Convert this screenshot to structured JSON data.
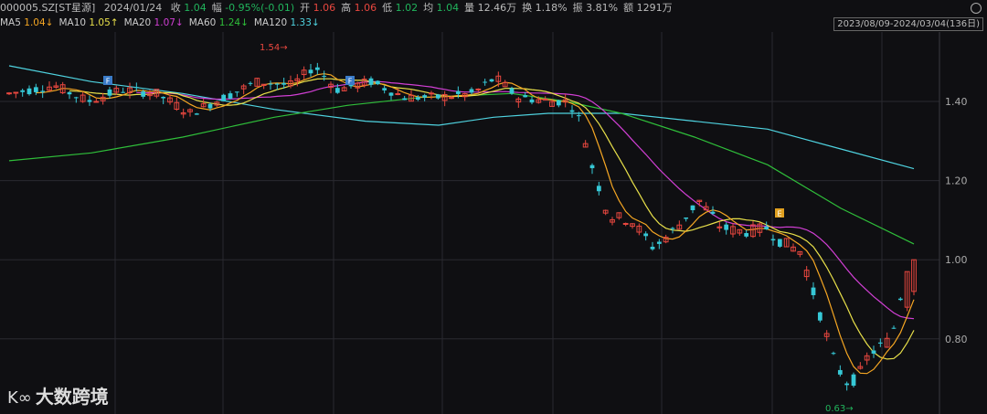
{
  "header": {
    "symbol": "000005.SZ[ST星源]",
    "date": "2024/01/24",
    "items": [
      {
        "label": "收",
        "value": "1.04",
        "color": "green"
      },
      {
        "label": "幅",
        "value": "-0.95%(-0.01)",
        "color": "green"
      },
      {
        "label": "开",
        "value": "1.06",
        "color": "red"
      },
      {
        "label": "高",
        "value": "1.06",
        "color": "red"
      },
      {
        "label": "低",
        "value": "1.02",
        "color": "green"
      },
      {
        "label": "均",
        "value": "1.04",
        "color": "green"
      },
      {
        "label": "量",
        "value": "12.46万",
        "color": "gray"
      },
      {
        "label": "换",
        "value": "1.18%",
        "color": "gray"
      },
      {
        "label": "振",
        "value": "3.81%",
        "color": "gray"
      },
      {
        "label": "额",
        "value": "1291万",
        "color": "gray"
      }
    ]
  },
  "ma_legend": [
    {
      "name": "MA5",
      "value": "1.04",
      "arrow": "↓",
      "color": "#f5a623"
    },
    {
      "name": "MA10",
      "value": "1.05",
      "arrow": "↑",
      "color": "#e8e04a"
    },
    {
      "name": "MA20",
      "value": "1.07",
      "arrow": "↓",
      "color": "#d13fd4"
    },
    {
      "name": "MA60",
      "value": "1.24",
      "arrow": "↓",
      "color": "#2fbf3a"
    },
    {
      "name": "MA120",
      "value": "1.33",
      "arrow": "↓",
      "color": "#4fd3e0"
    }
  ],
  "date_range": "2023/08/09-2024/03/04(136日)",
  "logo_text": "大数跨境",
  "logo_mark": "K∞",
  "colors": {
    "up": "#e8473f",
    "down": "#36c8d6",
    "bg": "#0f0f12",
    "grid": "#2a2a30"
  },
  "chart_data": {
    "type": "candlestick",
    "y_ticks": [
      "1.40",
      "1.20",
      "1.00",
      "0.80"
    ],
    "ylim": [
      0.6,
      1.56
    ],
    "annotations": [
      {
        "text": "1.54",
        "kind": "high"
      },
      {
        "text": "0.63",
        "kind": "low"
      }
    ],
    "event_markers": [
      "F",
      "F",
      "E"
    ],
    "ma5": [
      1.42,
      1.43,
      1.42,
      1.41,
      1.39,
      1.38,
      1.4,
      1.41,
      1.42,
      1.43,
      1.42,
      1.41,
      1.4,
      1.41,
      1.42,
      1.43,
      1.44,
      1.43,
      1.44,
      1.46,
      1.47,
      1.46,
      1.45,
      1.44,
      1.43,
      1.41,
      1.41,
      1.42,
      1.41,
      1.41,
      1.41,
      1.41,
      1.4,
      1.4,
      1.4,
      1.41,
      1.41,
      1.42,
      1.42,
      1.41,
      1.41,
      1.4,
      1.39,
      1.38,
      1.36,
      1.32,
      1.24,
      1.15,
      1.09,
      1.06,
      1.05,
      1.04,
      1.03,
      1.03,
      1.05,
      1.07,
      1.08,
      1.08,
      1.07,
      1.07,
      1.07,
      1.06,
      1.06,
      1.05,
      1.05,
      1.05,
      1.06,
      1.05,
      1.04,
      1.03,
      1.01,
      0.98,
      0.93,
      0.87,
      0.81,
      0.75,
      0.73,
      0.74,
      0.78,
      0.84,
      0.89,
      0.91
    ],
    "ma120": [
      1.49,
      1.48,
      1.47,
      1.46,
      1.45,
      1.44,
      1.43,
      1.42,
      1.41,
      1.4,
      1.39,
      1.38,
      1.37,
      1.36,
      1.36,
      1.35,
      1.35,
      1.34,
      1.34,
      1.34,
      1.34,
      1.35,
      1.36,
      1.37,
      1.37,
      1.37,
      1.37,
      1.36,
      1.36,
      1.36,
      1.35,
      1.35,
      1.34,
      1.33,
      1.32,
      1.31,
      1.3,
      1.28,
      1.27,
      1.25,
      1.24,
      1.23
    ]
  }
}
